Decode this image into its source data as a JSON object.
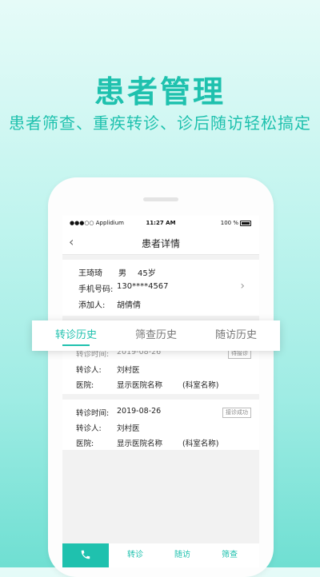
{
  "promo": {
    "title": "患者管理",
    "subtitle": "患者筛查、重疾转诊、诊后随访轻松搞定"
  },
  "statusbar": {
    "carrier": "●●●○○ Applidium",
    "time": "11:27 AM",
    "battery": "100 %"
  },
  "nav": {
    "title": "患者详情"
  },
  "patient": {
    "name": "王琦琦",
    "gender": "男",
    "age": "45岁",
    "phone_label": "手机号码:",
    "phone": "130****4567",
    "added_by_label": "添加人:",
    "added_by": "胡倩倩"
  },
  "tabs": [
    {
      "label": "转诊历史",
      "active": true
    },
    {
      "label": "筛查历史",
      "active": false
    },
    {
      "label": "随访历史",
      "active": false
    }
  ],
  "records": [
    {
      "time_label": "转诊时间:",
      "time": "2019-08-26",
      "status": "待接诊",
      "person_label": "转诊人:",
      "person": "刘村医",
      "hospital_label": "医院:",
      "hospital": "显示医院名称",
      "dept": "(科室名称)"
    },
    {
      "time_label": "转诊时间:",
      "time": "2019-08-26",
      "status": "接诊成功",
      "person_label": "转诊人:",
      "person": "刘村医",
      "hospital_label": "医院:",
      "hospital": "显示医院名称",
      "dept": "(科室名称)"
    }
  ],
  "bottom_nav": {
    "items": [
      "转诊",
      "随访",
      "筛查"
    ]
  },
  "colors": {
    "accent": "#1fc1ae",
    "background_top": "#e6fbf8",
    "background_bottom": "#6fdfd2"
  }
}
